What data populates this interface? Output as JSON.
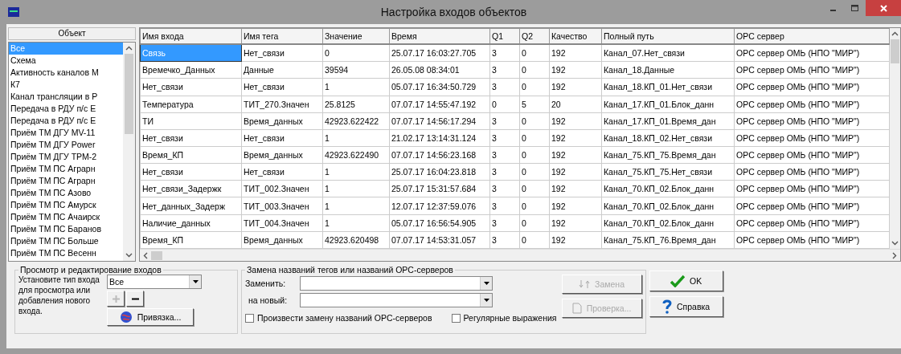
{
  "window": {
    "title": "Настройка входов объектов"
  },
  "object_list": {
    "header": "Объект",
    "items": [
      {
        "label": "Все",
        "selected": true
      },
      {
        "label": "Схема",
        "selected": false
      },
      {
        "label": "Активность каналов М",
        "selected": false
      },
      {
        "label": "К7",
        "selected": false
      },
      {
        "label": "Канал трансляции в Р",
        "selected": false
      },
      {
        "label": "Передача в РДУ п/с Е",
        "selected": false
      },
      {
        "label": "Передача в РДУ п/с Е",
        "selected": false
      },
      {
        "label": "Приём ТМ ДГУ MV-11",
        "selected": false
      },
      {
        "label": "Приём ТМ ДГУ Power",
        "selected": false
      },
      {
        "label": "Приём ТМ ДГУ ТРМ-2",
        "selected": false
      },
      {
        "label": "Приём ТМ ПС Аграрн",
        "selected": false
      },
      {
        "label": "Приём ТМ ПС Аграрн",
        "selected": false
      },
      {
        "label": "Приём ТМ ПС Азово",
        "selected": false
      },
      {
        "label": "Приём ТМ ПС Амурск",
        "selected": false
      },
      {
        "label": "Приём ТМ ПС Ачаирск",
        "selected": false
      },
      {
        "label": "Приём ТМ ПС Баранов",
        "selected": false
      },
      {
        "label": "Приём ТМ ПС Больше",
        "selected": false
      },
      {
        "label": "Приём ТМ ПС Весенн",
        "selected": false
      }
    ]
  },
  "table": {
    "columns": [
      "Имя входа",
      "Имя тега",
      "Значение",
      "Время",
      "Q1",
      "Q2",
      "Качество",
      "Полный путь",
      "OPC сервер"
    ],
    "rows": [
      {
        "selected": true,
        "cells": [
          "Связь",
          "Нет_связи",
          "0",
          "25.07.17 16:03:27.705",
          "3",
          "0",
          "192",
          "Канал_07.Нет_связи",
          "OPC сервер ОМЬ (НПО \"МИР\")"
        ]
      },
      {
        "selected": false,
        "cells": [
          "Времечко_Данных",
          "Данные",
          "39594",
          "26.05.08 08:34:01",
          "3",
          "0",
          "192",
          "Канал_18.Данные",
          "OPC сервер ОМЬ (НПО \"МИР\")"
        ]
      },
      {
        "selected": false,
        "cells": [
          "Нет_связи",
          "Нет_связи",
          "1",
          "05.07.17 16:34:50.729",
          "3",
          "0",
          "192",
          "Канал_18.КП_01.Нет_связи",
          "OPC сервер ОМЬ (НПО \"МИР\")"
        ]
      },
      {
        "selected": false,
        "cells": [
          "Температура",
          "ТИТ_270.Значен",
          "25.8125",
          "07.07.17 14:55:47.192",
          "0",
          "5",
          "20",
          "Канал_17.КП_01.Блок_данн",
          "OPC сервер ОМЬ (НПО \"МИР\")"
        ]
      },
      {
        "selected": false,
        "cells": [
          "ТИ",
          "Время_данных",
          "42923.622422",
          "07.07.17 14:56:17.294",
          "3",
          "0",
          "192",
          "Канал_17.КП_01.Время_дан",
          "OPC сервер ОМЬ (НПО \"МИР\")"
        ]
      },
      {
        "selected": false,
        "cells": [
          "Нет_связи",
          "Нет_связи",
          "1",
          "21.02.17 13:14:31.124",
          "3",
          "0",
          "192",
          "Канал_18.КП_02.Нет_связи",
          "OPC сервер ОМЬ (НПО \"МИР\")"
        ]
      },
      {
        "selected": false,
        "cells": [
          "Время_КП",
          "Время_данных",
          "42923.622490",
          "07.07.17 14:56:23.168",
          "3",
          "0",
          "192",
          "Канал_75.КП_75.Время_дан",
          "OPC сервер ОМЬ (НПО \"МИР\")"
        ]
      },
      {
        "selected": false,
        "cells": [
          "Нет_связи",
          "Нет_связи",
          "1",
          "25.07.17 16:04:23.818",
          "3",
          "0",
          "192",
          "Канал_75.КП_75.Нет_связи",
          "OPC сервер ОМЬ (НПО \"МИР\")"
        ]
      },
      {
        "selected": false,
        "cells": [
          "Нет_связи_Задержк",
          "ТИТ_002.Значен",
          "1",
          "25.07.17 15:31:57.684",
          "3",
          "0",
          "192",
          "Канал_70.КП_02.Блок_данн",
          "OPC сервер ОМЬ (НПО \"МИР\")"
        ]
      },
      {
        "selected": false,
        "cells": [
          "Нет_данных_Задерж",
          "ТИТ_003.Значен",
          "1",
          "12.07.17 12:37:59.076",
          "3",
          "0",
          "192",
          "Канал_70.КП_02.Блок_данн",
          "OPC сервер ОМЬ (НПО \"МИР\")"
        ]
      },
      {
        "selected": false,
        "cells": [
          "Наличие_данных",
          "ТИТ_004.Значен",
          "1",
          "05.07.17 16:56:54.905",
          "3",
          "0",
          "192",
          "Канал_70.КП_02.Блок_данн",
          "OPC сервер ОМЬ (НПО \"МИР\")"
        ]
      },
      {
        "selected": false,
        "cells": [
          "Время_КП",
          "Время_данных",
          "42923.620498",
          "07.07.17 14:53:31.057",
          "3",
          "0",
          "192",
          "Канал_75.КП_76.Время_дан",
          "OPC сервер ОМЬ (НПО \"МИР\")"
        ]
      }
    ]
  },
  "view_group": {
    "title": "Просмотр и редактирование входов",
    "hint": "Установите тип входа для просмотра или добавления нового входа.",
    "type_value": "Все",
    "add_disabled": true,
    "remove_disabled": false,
    "bind_button": "Привязка..."
  },
  "replace_group": {
    "title": "Замена названий тегов или названий OPC-серверов",
    "replace_label": "Заменить:",
    "new_label": "на новый:",
    "replace_button": {
      "label": "Замена",
      "disabled": true
    },
    "check_button": {
      "label": "Проверка...",
      "disabled": true
    },
    "checkboxes": [
      {
        "label": "Произвести замену названий OPC-серверов",
        "checked": false
      },
      {
        "label": "Регулярные выражения",
        "checked": false
      }
    ]
  },
  "ok_button": "OK",
  "help_button": "Справка"
}
